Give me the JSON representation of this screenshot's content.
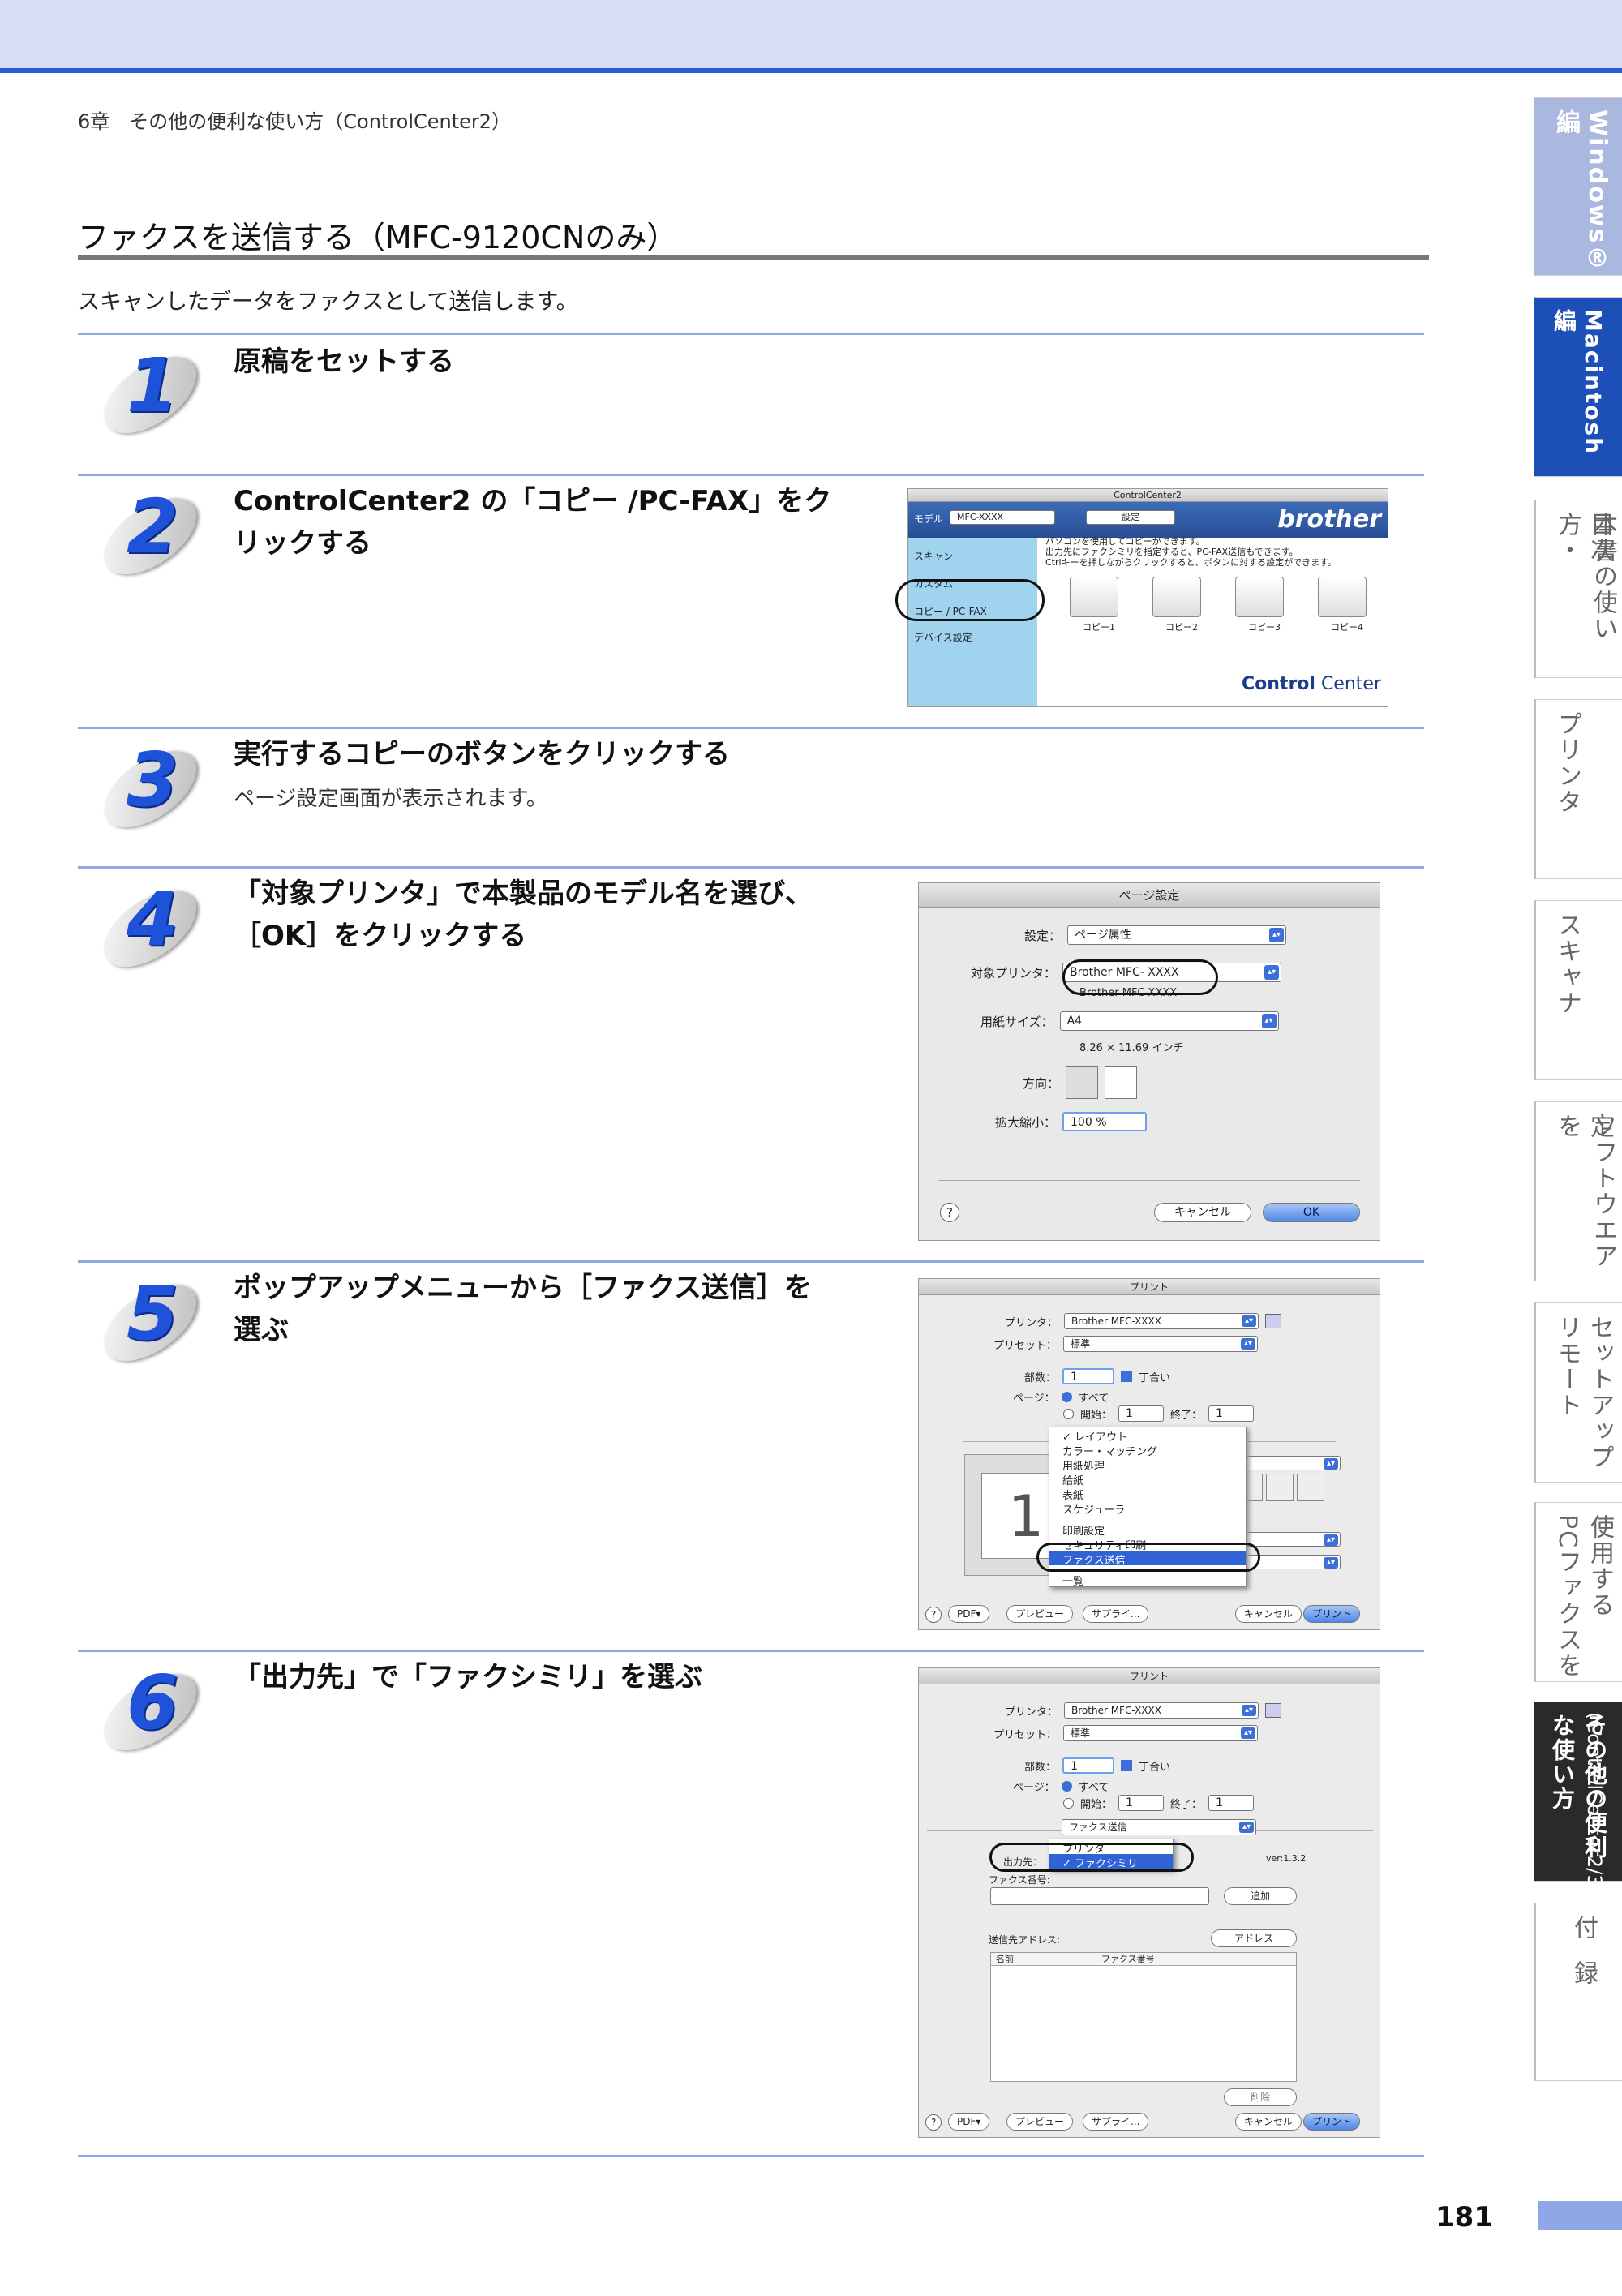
{
  "header": {
    "chapter": "6章　その他の便利な使い方（ControlCenter2）"
  },
  "section": {
    "title": "ファクスを送信する（MFC-9120CNのみ）",
    "intro": "スキャンしたデータをファクスとして送信します。"
  },
  "steps": [
    {
      "num": "1",
      "title": "原稿をセットする"
    },
    {
      "num": "2",
      "title_l1": "ControlCenter2 の「コピー /PC-FAX」をク",
      "title_l2": "リックする"
    },
    {
      "num": "3",
      "title": "実行するコピーのボタンをクリックする",
      "sub": "ページ設定画面が表示されます。"
    },
    {
      "num": "4",
      "title_l1": "「対象プリンタ」で本製品のモデル名を選び、",
      "title_l2": "［OK］をクリックする"
    },
    {
      "num": "5",
      "title_l1": "ポップアップメニューから［ファクス送信］を",
      "title_l2": "選ぶ"
    },
    {
      "num": "6",
      "title": "「出力先」で「ファクシミリ」を選ぶ"
    }
  ],
  "cc": {
    "window_title": "ControlCenter2",
    "model_label": "モデル",
    "model_value": "MFC-XXXX",
    "settings_value": "設定",
    "brand": "brother",
    "desc1": "パソコンを使用してコピーができます。",
    "desc2": "出力先にファクシミリを指定すると、PC-FAX送信もできます。",
    "desc3": "Ctrlキーを押しながらクリックすると、ボタンに対する設定ができます。",
    "menu": [
      "スキャン",
      "カスタム",
      "コピー / PC-FAX",
      "デバイス設定"
    ],
    "copies": [
      "コピー1",
      "コピー2",
      "コピー3",
      "コピー4"
    ],
    "logo_bold": "Control",
    "logo_light": " Center"
  },
  "pagesetup": {
    "window_title": "ページ設定",
    "settings_label": "設定：",
    "settings_value": "ページ属性",
    "printer_label": "対象プリンタ：",
    "printer_value": "Brother MFC- XXXX",
    "printer_sub": "Brother MFC-XXXX",
    "paper_label": "用紙サイズ：",
    "paper_value": "A4",
    "paper_sub": "8.26 × 11.69 インチ",
    "orient_label": "方向：",
    "scale_label": "拡大縮小：",
    "scale_value": "100 %",
    "cancel": "キャンセル",
    "ok": "OK",
    "help": "?"
  },
  "print1": {
    "window_title": "プリント",
    "printer_label": "プリンタ：",
    "printer_value": "Brother MFC-XXXX",
    "preset_label": "プリセット：",
    "preset_value": "標準",
    "copies_label": "部数：",
    "copies_value": "1",
    "collate": "丁合い",
    "pages_label": "ページ：",
    "all": "すべて",
    "from": "開始：",
    "from_value": "1",
    "to": "終了：",
    "to_value": "1",
    "menu": [
      "✓ レイアウト",
      "カラー・マッチング",
      "用紙処理",
      "給紙",
      "表紙",
      "スケジューラ",
      "",
      "印刷設定",
      "セキュリティ印刷",
      "ファクス送信",
      "",
      "一覧"
    ],
    "preview_num": "1",
    "pdf": "PDF▾",
    "preview": "プレビュー",
    "supplies": "サプライ...",
    "cancel": "キャンセル",
    "print": "プリント",
    "help": "?"
  },
  "print2": {
    "window_title": "プリント",
    "printer_label": "プリンタ：",
    "printer_value": "Brother MFC-XXXX",
    "preset_label": "プリセット：",
    "preset_value": "標準",
    "copies_label": "部数：",
    "copies_value": "1",
    "collate": "丁合い",
    "pages_label": "ページ：",
    "all": "すべて",
    "from": "開始：",
    "from_value": "1",
    "to": "終了：",
    "to_value": "1",
    "mode_value": "ファクス送信",
    "opt_printer": "プリンタ",
    "opt_fax": "✓ ファクシミリ",
    "dest_label": "出力先：",
    "version": "ver:1.3.2",
    "faxno_label": "ファクス番号:",
    "add": "追加",
    "addr_label": "送信先アドレス:",
    "addr_btn": "アドレス",
    "col_name": "名前",
    "col_fax": "ファクス番号",
    "delete": "削除",
    "pdf": "PDF▾",
    "preview": "プレビュー",
    "supplies": "サプライ...",
    "cancel": "キャンセル",
    "print": "プリント",
    "help": "?"
  },
  "tabs": {
    "windows": "Windows®編",
    "macintosh": "Macintosh編",
    "t1": "本書の使い方・",
    "t1b": "目次",
    "t2": "プリンタ",
    "t3": "スキャナ",
    "t4": "ソフトウエアを",
    "t4b": "使うための設定",
    "t5": "リモート",
    "t5b": "セットアップ",
    "t6": "PCファクスを",
    "t6b": "使用する",
    "t7": "その他の便利な使い方",
    "t7b": "(ControlCenter2/3)",
    "t8": "付",
    "t8b": "録"
  },
  "page": {
    "number": "181"
  }
}
